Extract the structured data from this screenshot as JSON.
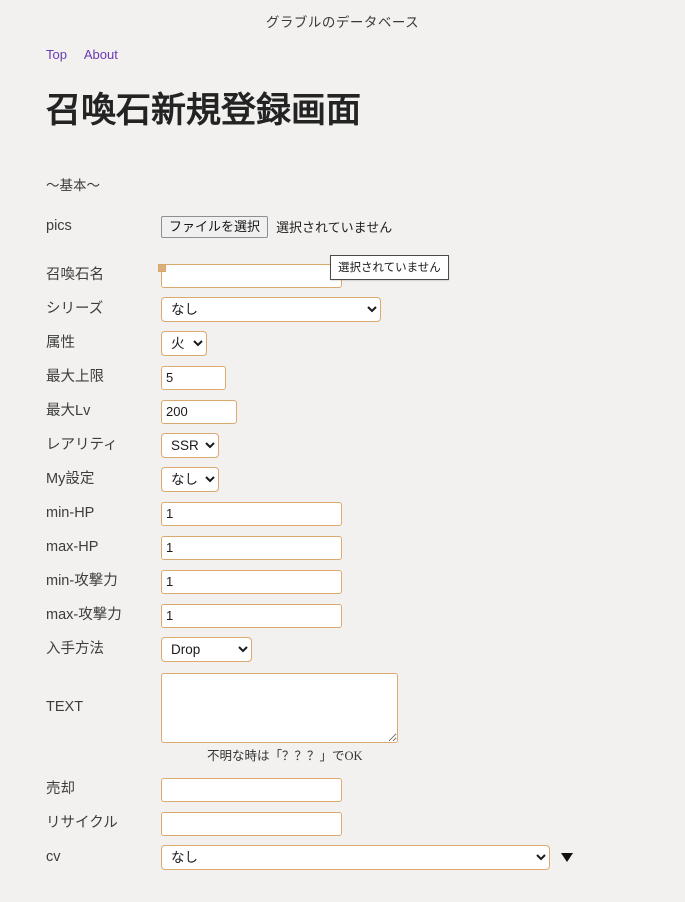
{
  "site": {
    "header_title": "グラブルのデータベース",
    "nav": [
      {
        "label": "Top"
      },
      {
        "label": "About"
      }
    ]
  },
  "page": {
    "title": "召喚石新規登録画面",
    "section_label": "〜基本〜"
  },
  "form": {
    "rows": {
      "pics": {
        "label": "pics",
        "file_button": "ファイルを選択",
        "file_status": "選択されていません",
        "tooltip": "選択されていません"
      },
      "name": {
        "label": "召喚石名",
        "value": ""
      },
      "series": {
        "label": "シリーズ",
        "value": "なし"
      },
      "element": {
        "label": "属性",
        "value": "火"
      },
      "max_uncap": {
        "label": "最大上限",
        "value": "5"
      },
      "max_lv": {
        "label": "最大Lv",
        "value": "200"
      },
      "rarity": {
        "label": "レアリティ",
        "value": "SSR"
      },
      "my_setting": {
        "label": "My設定",
        "value": "なし"
      },
      "min_hp": {
        "label": "min-HP",
        "value": "1"
      },
      "max_hp": {
        "label": "max-HP",
        "value": "1"
      },
      "min_atk": {
        "label": "min-攻撃力",
        "value": "1"
      },
      "max_atk": {
        "label": "max-攻撃力",
        "value": "1"
      },
      "obtain": {
        "label": "入手方法",
        "value": "Drop"
      },
      "text": {
        "label": "TEXT",
        "value": "",
        "help": "不明な時は「？？？」でOK"
      },
      "sell": {
        "label": "売却",
        "value": ""
      },
      "recycle": {
        "label": "リサイクル",
        "value": ""
      },
      "cv": {
        "label": "cv",
        "value": "なし",
        "marker_icon": "triangle-down-icon"
      }
    }
  },
  "colors": {
    "page_background": "#f2f1ef",
    "field_border": "#dca96e",
    "link": "#6a3ab2",
    "label_text": "#3d3d3d"
  }
}
